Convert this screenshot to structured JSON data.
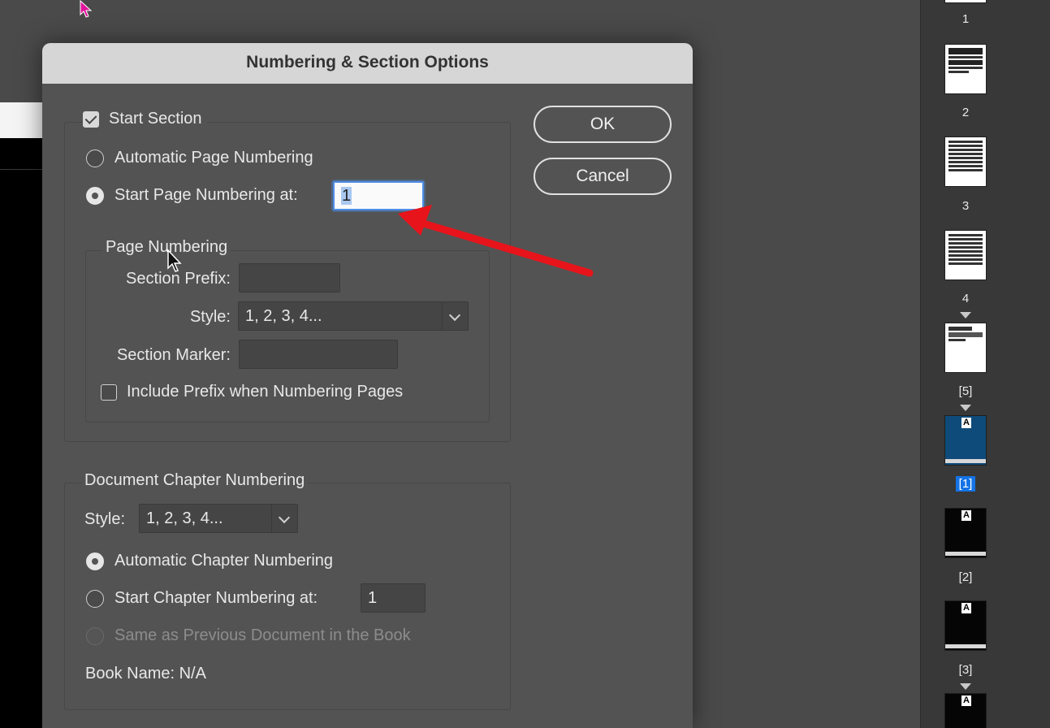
{
  "dialog": {
    "title": "Numbering & Section Options",
    "start_section_label": "Start Section",
    "automatic_page_numbering_label": "Automatic Page Numbering",
    "start_page_numbering_label": "Start Page Numbering at:",
    "start_page_numbering_value": "1",
    "page_numbering": {
      "group_label": "Page Numbering",
      "section_prefix_label": "Section Prefix:",
      "section_prefix_value": "",
      "style_label": "Style:",
      "style_value": "1, 2, 3, 4...",
      "section_marker_label": "Section Marker:",
      "section_marker_value": "",
      "include_prefix_label": "Include Prefix when Numbering Pages"
    },
    "chapter": {
      "group_label": "Document Chapter Numbering",
      "style_label": "Style:",
      "style_value": "1, 2, 3, 4...",
      "automatic_label": "Automatic Chapter Numbering",
      "start_label": "Start Chapter Numbering at:",
      "start_value": "1",
      "same_as_previous_label": "Same as Previous Document in the Book",
      "book_name_label": "Book Name: N/A"
    },
    "ok_label": "OK",
    "cancel_label": "Cancel"
  },
  "pages_panel": {
    "labels": [
      "1",
      "2",
      "3",
      "4",
      "[5]",
      "[1]",
      "[2]",
      "[3]"
    ],
    "master_letter": "A",
    "selected_label": "[1]"
  },
  "colors": {
    "annotation_arrow": "#e8141b",
    "selection_blue": "#1473e6",
    "focus_ring": "#4e8ee8"
  }
}
